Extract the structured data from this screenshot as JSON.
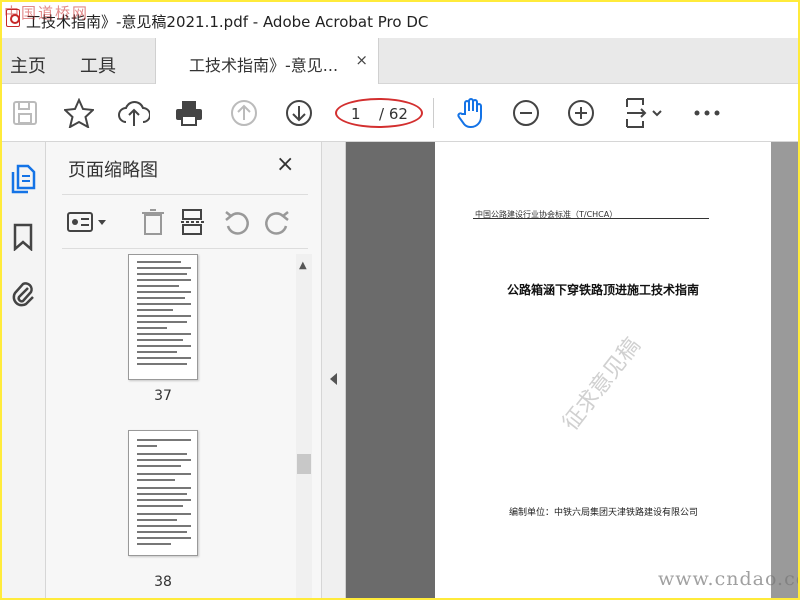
{
  "window": {
    "title": "工技术指南》-意见稿2021.1.pdf - Adobe Acrobat Pro DC",
    "watermark": "中国道桥网"
  },
  "tabs": {
    "home": "主页",
    "tools": "工具",
    "document": "工技术指南》-意见...",
    "close": "×"
  },
  "toolbar": {
    "current_page": "1",
    "total_pages": "/ 62",
    "icons": [
      "save-icon",
      "star-icon",
      "cloud-upload-icon",
      "print-icon",
      "page-up-icon",
      "page-down-icon",
      "hand-icon",
      "zoom-out-icon",
      "zoom-in-icon",
      "fit-page-icon",
      "more-icon"
    ]
  },
  "sidebar": {
    "rail_icons": [
      "pages-icon",
      "bookmark-icon",
      "attachment-icon"
    ],
    "panel_title": "页面缩略图",
    "close": "×",
    "thumbnails": [
      {
        "page": "37"
      },
      {
        "page": "38"
      }
    ]
  },
  "document": {
    "header": "中国公路建设行业协会标准（T/CHCA）",
    "title": "公路箱涵下穿铁路顶进施工技术指南",
    "stamp": "征求意见稿",
    "editor": "编制单位：中铁六局集团天津铁路建设有限公司"
  },
  "footer_watermark": "www.cndao.co",
  "colors": {
    "accent": "#1473e6",
    "highlight_circle": "#d32f2f",
    "frame": "#ffeb3b"
  }
}
